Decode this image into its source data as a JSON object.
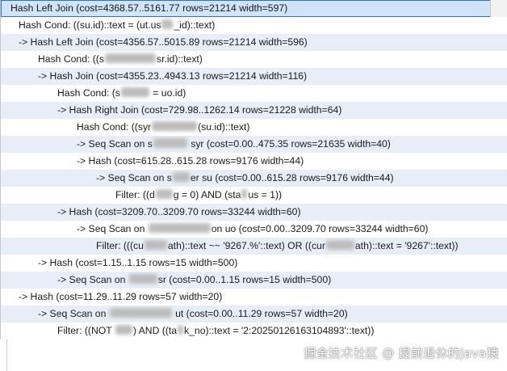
{
  "plan_rows": [
    {
      "text": "Hash Left Join  (cost=4368.57..5161.77 rows=21214 width=597)"
    },
    {
      "text": "Hash Cond: ((su.id)::text = (ut.us██_id)::text)"
    },
    {
      "text": "->  Hash Left Join  (cost=4356.57..5015.89 rows=21214 width=596)"
    },
    {
      "text": "Hash Cond: ((s█████████sr.id)::text)"
    },
    {
      "text": "->  Hash Join  (cost=4355.23..4943.13 rows=21214 width=116)"
    },
    {
      "text": "Hash Cond: (s█████ = uo.id)"
    },
    {
      "text": "->  Hash Right Join  (cost=729.98..1262.14 rows=21228 width=64)"
    },
    {
      "text": "Hash Cond: ((syr████████(su.id)::text)"
    },
    {
      "text": "->  Seq Scan on s██████ syr  (cost=0.00..475.35 rows=21635 width=40)"
    },
    {
      "text": "->  Hash  (cost=615.28..615.28 rows=9176 width=44)"
    },
    {
      "text": "->  Seq Scan on s███er su  (cost=0.00..615.28 rows=9176 width=44)"
    },
    {
      "text": "Filter: ((d███g = 0) AND (sta█us = 1))"
    },
    {
      "text": "->  Hash  (cost=3209.70..3209.70 rows=33244 width=60)"
    },
    {
      "text": "->  Seq Scan on ███████████on uo  (cost=0.00..3209.70 rows=33244 width=60)"
    },
    {
      "text": "Filter: (((cu████ath)::text ~~ '9267.%'::text) OR ((cur█████ath)::text = '9267'::text))"
    },
    {
      "text": "->  Hash  (cost=1.15..1.15 rows=15 width=500)"
    },
    {
      "text": "->  Seq Scan on █████sr  (cost=0.00..1.15 rows=15 width=500)"
    },
    {
      "text": "->  Hash  (cost=11.29..11.29 rows=57 width=20)"
    },
    {
      "text": "->  Seq Scan on ███████████ ut  (cost=0.00..11.29 rows=57 width=20)"
    },
    {
      "text": "Filter: ((NOT ███) AND ((ta█k_no)::text = '2:20250126163104893'::text))"
    }
  ],
  "watermark": "掘金技术社区 @ 提前退休的java猿"
}
